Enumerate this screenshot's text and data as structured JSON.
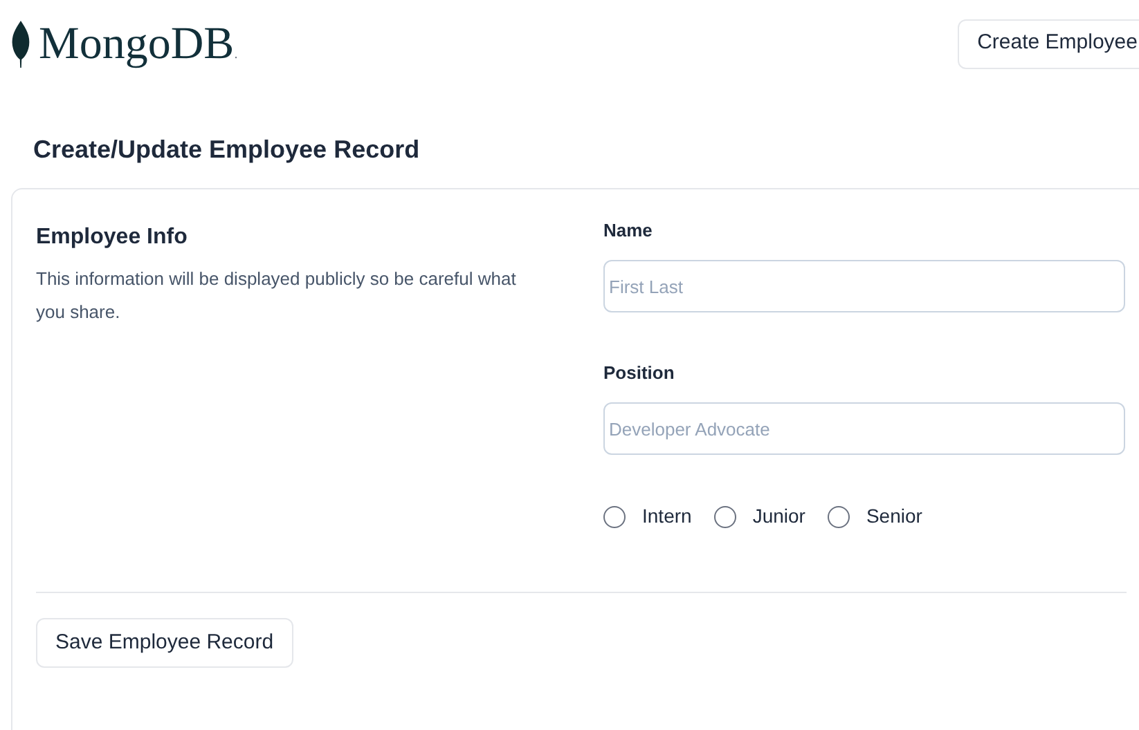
{
  "header": {
    "logo_text": "MongoDB",
    "logo_mark": ".",
    "create_button": "Create Employee"
  },
  "page_title": "Create/Update Employee Record",
  "form": {
    "section_title": "Employee Info",
    "section_description": "This information will be displayed publicly so be careful what you share.",
    "fields": [
      {
        "label": "Name",
        "placeholder": "First Last"
      },
      {
        "label": "Position",
        "placeholder": "Developer Advocate"
      }
    ],
    "levels": [
      {
        "label": "Intern",
        "selected": false
      },
      {
        "label": "Junior",
        "selected": false
      },
      {
        "label": "Senior",
        "selected": false
      }
    ],
    "save_button": "Save Employee Record"
  }
}
